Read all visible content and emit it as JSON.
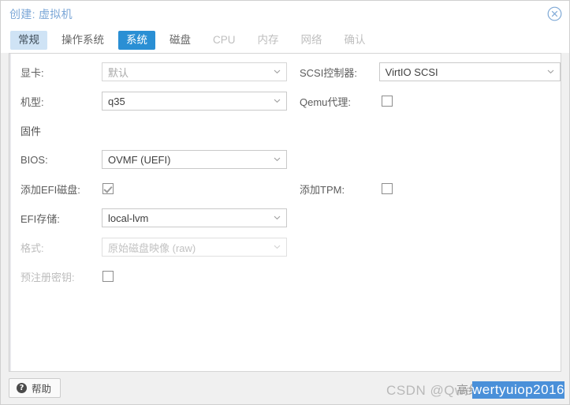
{
  "window": {
    "title": "创建: 虚拟机",
    "close_icon": "close-circle-icon"
  },
  "tabs": [
    {
      "label": "常规",
      "state": "visited"
    },
    {
      "label": "操作系统",
      "state": "visited"
    },
    {
      "label": "系统",
      "state": "active"
    },
    {
      "label": "磁盘",
      "state": "visited"
    },
    {
      "label": "CPU",
      "state": "disabled"
    },
    {
      "label": "内存",
      "state": "disabled"
    },
    {
      "label": "网络",
      "state": "disabled"
    },
    {
      "label": "确认",
      "state": "disabled"
    }
  ],
  "form": {
    "left": {
      "graphic_card": {
        "label": "显卡:",
        "value": "默认",
        "control": "select",
        "muted": true
      },
      "machine": {
        "label": "机型:",
        "value": "q35",
        "control": "select",
        "muted": false
      },
      "firmware": {
        "label": "固件",
        "control": "section"
      },
      "bios": {
        "label": "BIOS:",
        "value": "OVMF (UEFI)",
        "control": "select",
        "muted": false
      },
      "add_efi_disk": {
        "label": "添加EFI磁盘:",
        "checked": true,
        "control": "checkbox"
      },
      "efi_storage": {
        "label": "EFI存储:",
        "value": "local-lvm",
        "control": "select",
        "muted": false
      },
      "format": {
        "label": "格式:",
        "value": "原始磁盘映像 (raw)",
        "control": "select",
        "disabled": true
      },
      "pre_enroll": {
        "label": "预注册密钥:",
        "checked": false,
        "control": "checkbox"
      }
    },
    "right": {
      "scsi_controller": {
        "label": "SCSI控制器:",
        "value": "VirtIO SCSI",
        "control": "select",
        "muted": false
      },
      "qemu_agent": {
        "label": "Qemu代理:",
        "checked": false,
        "control": "checkbox"
      },
      "add_tpm": {
        "label": "添加TPM:",
        "checked": false,
        "control": "checkbox"
      }
    }
  },
  "footer": {
    "help_label": "帮助",
    "help_icon": "question-mark-icon"
  },
  "watermark": {
    "gray_text": "CSDN @Qwertyuiop2016",
    "selected_text": "wertyuiop2016",
    "cn_overlay": "高级忽略四海"
  },
  "colors": {
    "accent": "#2a8fd4",
    "tab_hover_bg": "#cfe3f5",
    "title": "#7ba7d7",
    "panel_bg": "#ffffff",
    "window_bg": "#f0f0f0",
    "watermark_select": "#4a90d9"
  }
}
